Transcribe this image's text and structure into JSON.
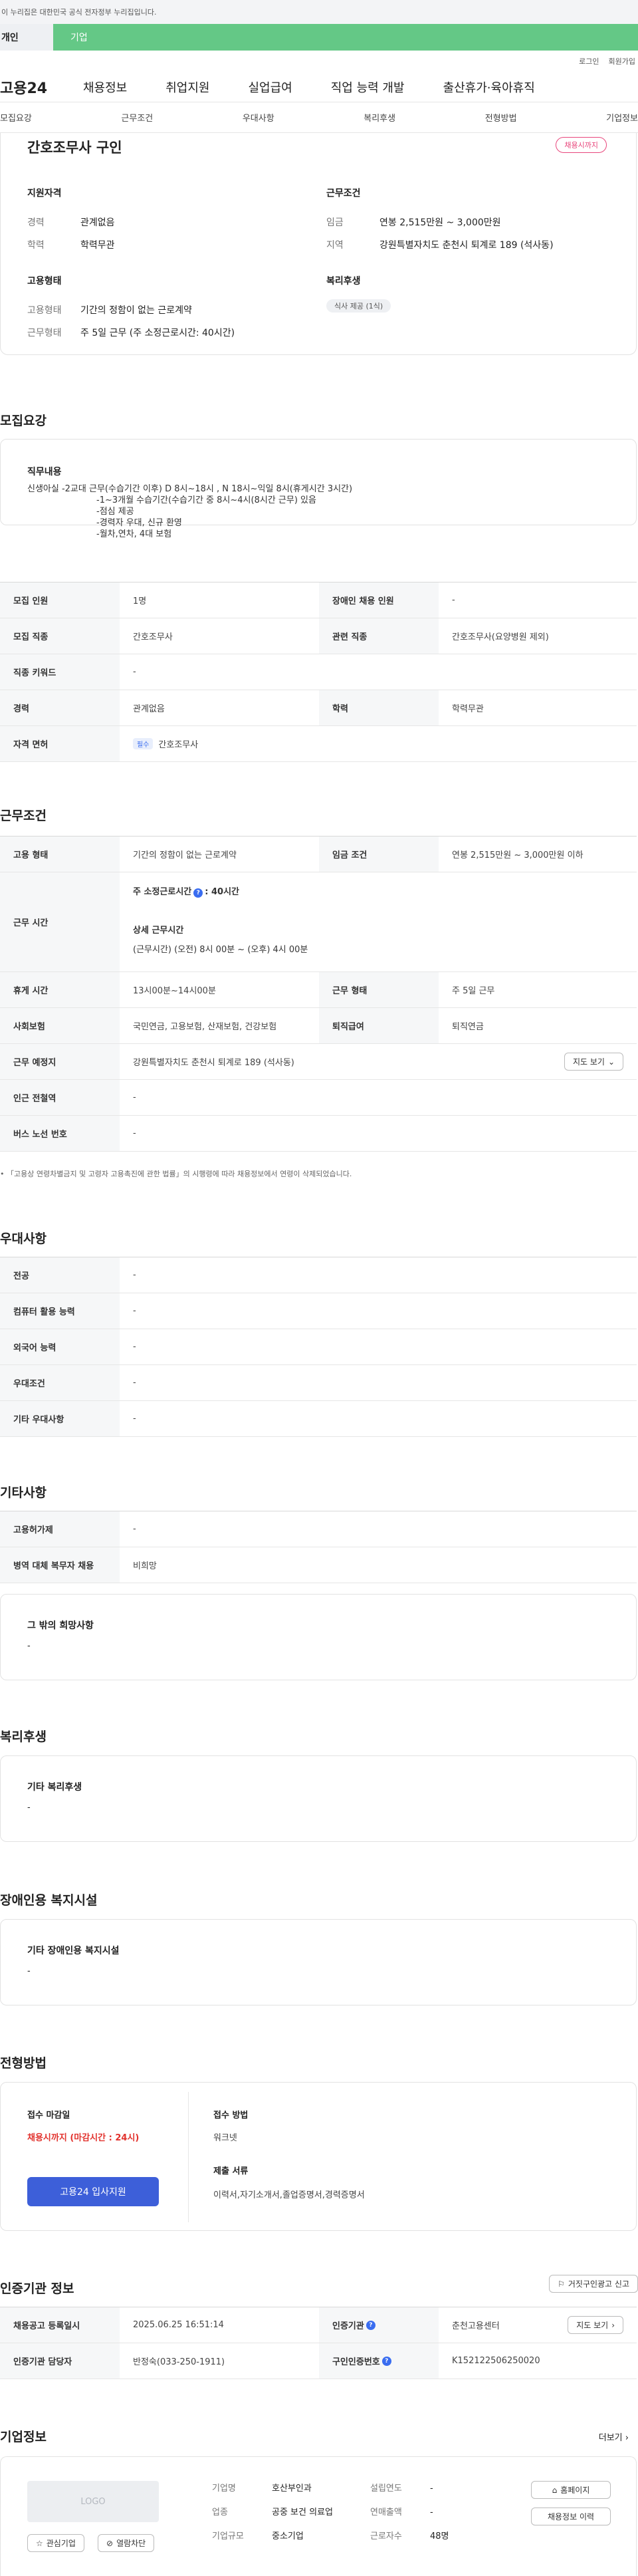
{
  "banner": "이 누리집은 대한민국 공식 전자정부 누리집입니다.",
  "user_tabs": {
    "personal": "개인",
    "company": "기업"
  },
  "util": {
    "login": "로그인",
    "join": "회원가입"
  },
  "gnb": {
    "logo": "고용24",
    "menus": [
      "채용정보",
      "취업지원",
      "실업급여",
      "직업 능력 개발",
      "출산휴가·육아휴직"
    ]
  },
  "lnb": [
    "모집요강",
    "근무조건",
    "우대사항",
    "복리후생",
    "전형방법",
    "기업정보"
  ],
  "summary": {
    "title": "간호조무사 구인",
    "status_badge": "채용시까지",
    "qualification": {
      "heading": "지원자격",
      "rows": [
        {
          "k": "경력",
          "v": "관계없음"
        },
        {
          "k": "학력",
          "v": "학력무관"
        }
      ]
    },
    "conditions": {
      "heading": "근무조건",
      "rows": [
        {
          "k": "임금",
          "v": "연봉 2,515만원 ~ 3,000만원"
        },
        {
          "k": "지역",
          "v": "강원특별자치도 춘천시 퇴계로 189 (석사동)"
        }
      ]
    },
    "employment": {
      "heading": "고용형태",
      "rows": [
        {
          "k": "고용형태",
          "v": "기간의 정함이 없는 근로계약"
        },
        {
          "k": "근무형태",
          "v": "주 5일 근무 (주 소정근로시간: 40시간)"
        }
      ]
    },
    "welfare": {
      "heading": "복리후생",
      "chip": "식사 제공 (1식)"
    }
  },
  "recruit": {
    "title": "모집요강",
    "duty_heading": "직무내용",
    "duty_lines": [
      "신생아실 -2교대 근무(수습기간 이후) D 8시~18시 , N 18시~익일 8시(휴게시간 3시간)",
      "-1~3개월 수습기간(수습기간 중  8시~4시(8시간 근무) 있음",
      "-점심 제공",
      "-경력자 우대, 신규 환영",
      "-월차,연차, 4대 보험"
    ],
    "rows": [
      {
        "l1": "모집 인원",
        "v1": "1명",
        "l2": "장애인 채용 인원",
        "v2": "-"
      },
      {
        "l1": "모집 직종",
        "v1": "간호조무사",
        "l2": "관련 직종",
        "v2": "간호조무사(요양병원 제외)"
      },
      {
        "l1": "직종 키워드",
        "v1": "-"
      },
      {
        "l1": "경력",
        "v1": "관계없음",
        "l2": "학력",
        "v2": "학력무관"
      }
    ],
    "license": {
      "label": "자격 면허",
      "tag": "필수",
      "value": "간호조무사"
    }
  },
  "work": {
    "title": "근무조건",
    "employment": {
      "label": "고용 형태",
      "value": "기간의 정함이 없는 근로계약",
      "l2": "임금 조건",
      "v2": "연봉 2,515만원 ~ 3,000만원 이하"
    },
    "hours": {
      "label": "근무 시간",
      "weekly_label": "주 소정근로시간",
      "weekly_value": ": 40시간",
      "detail_label": "상세 근무시간",
      "detail_value": "(근무시간) (오전) 8시 00분 ~ (오후) 4시 00분"
    },
    "rest": {
      "label": "휴게 시간",
      "value": "13시00분~14시00분",
      "l2": "근무 형태",
      "v2": "주 5일 근무"
    },
    "insurance": {
      "label": "사회보험",
      "value": "국민연금, 고용보험, 산재보험, 건강보험",
      "l2": "퇴직급여",
      "v2": "퇴직연금"
    },
    "place": {
      "label": "근무 예정지",
      "value": "강원특별자치도 춘천시 퇴계로 189 (석사동)",
      "map_btn": "지도 보기"
    },
    "subway": {
      "label": "인근 전철역",
      "value": "-"
    },
    "bus": {
      "label": "버스 노선 번호",
      "value": "-"
    },
    "notice": "「고용상 연령차별금지 및 고령자 고용촉진에 관한 법률」의 시행령에 따라 채용정보에서 연령이 삭제되었습니다."
  },
  "prefer": {
    "title": "우대사항",
    "rows": [
      {
        "label": "전공",
        "value": "-"
      },
      {
        "label": "컴퓨터 활용 능력",
        "value": "-"
      },
      {
        "label": "외국어 능력",
        "value": "-"
      },
      {
        "label": "우대조건",
        "value": "-"
      },
      {
        "label": "기타 우대사항",
        "value": "-"
      }
    ]
  },
  "etc": {
    "title": "기타사항",
    "rows": [
      {
        "label": "고용허가제",
        "value": "-"
      },
      {
        "label": "병역 대체 복무자 채용",
        "value": "비희망"
      }
    ],
    "other_heading": "그 밖의 희망사항",
    "other_value": "-"
  },
  "benefit": {
    "title": "복리후생",
    "heading": "기타 복리후생",
    "value": "-"
  },
  "disabled": {
    "title": "장애인용 복지시설",
    "heading": "기타 장애인용 복지시설",
    "value": "-"
  },
  "process": {
    "title": "전형방법",
    "deadline_label": "접수 마감일",
    "deadline_value": "채용시까지 (마감시간 : 24시)",
    "apply_btn": "고용24 입사지원",
    "method_label": "접수 방법",
    "method_value": "워크넷",
    "docs_label": "제출 서류",
    "docs_value": "이력서,자기소개서,졸업증명서,경력증명서"
  },
  "agency": {
    "title": "인증기관 정보",
    "report_btn": "거짓구인광고 신고",
    "rows": [
      {
        "l1": "채용공고 등록일시",
        "v1": "2025.06.25 16:51:14",
        "l2": "인증기관",
        "v2": "춘천고용센터",
        "btn": "지도 보기"
      },
      {
        "l1": "인증기관 담당자",
        "v1": "반정숙(033-250-1911)",
        "l2": "구인인증번호",
        "v2": "K152122506250020"
      }
    ]
  },
  "company": {
    "title": "기업정보",
    "more": "더보기",
    "logo": "LOGO",
    "fav_btn": "관심기업",
    "block_btn": "열람차단",
    "fields": [
      {
        "k": "기업명",
        "v": "호산부인과"
      },
      {
        "k": "업종",
        "v": "공중 보건 의료업"
      },
      {
        "k": "기업규모",
        "v": "중소기업"
      }
    ],
    "fields2": [
      {
        "k": "설립연도",
        "v": "-"
      },
      {
        "k": "연매출액",
        "v": "-"
      },
      {
        "k": "근로자수",
        "v": "48명"
      }
    ],
    "homepage_btn": "홈페이지",
    "history_btn": "채용정보 이력"
  }
}
